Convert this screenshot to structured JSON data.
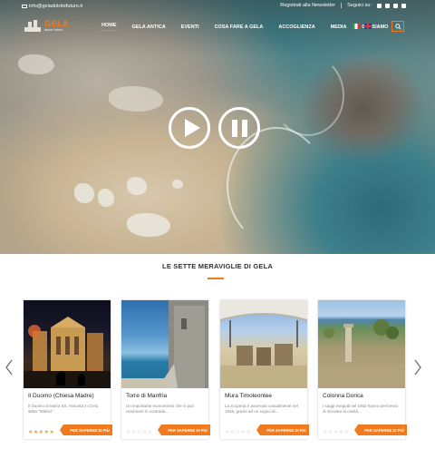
{
  "topbar": {
    "email": "info@geladolcitefuturo.it",
    "newsletter": "Registrati alla Newsletter",
    "follow": "Seguici su:",
    "social_icons": [
      "facebook-icon",
      "twitter-icon",
      "instagram-icon",
      "youtube-icon"
    ]
  },
  "logo": {
    "word": "GELA",
    "sub": "dolce futuro"
  },
  "nav": {
    "items": [
      "HOME",
      "GELA ANTICA",
      "EVENTI",
      "COSA FARE A GELA",
      "ACCOGLIENZA",
      "MEDIA",
      "CHI SIAMO"
    ],
    "active": "HOME"
  },
  "languages": [
    "it",
    "en"
  ],
  "section": {
    "title": "LE SETTE MERAVIGLIE DI GELA"
  },
  "cards": [
    {
      "name": "Il Duomo (Chiesa Madre)",
      "desc": "Il Duomo di Maria SS. Assunta in Cielo, detta \"Matrici\"",
      "stars": "★★★★★",
      "stars_filled": 5,
      "more": "PER SAPERNE DI PIÙ"
    },
    {
      "name": "Torre di Manfria",
      "desc": "Un importante monumento che si può osservare in contrada...",
      "stars": "☆☆☆☆☆",
      "stars_filled": 0,
      "more": "PER SAPERNE DI PIÙ"
    },
    {
      "name": "Mura Timoleontee",
      "desc": "La scoperta è avvenuta casualmente nel 1948, grazie ad un sogno di...",
      "stars": "☆☆☆☆☆",
      "stars_filled": 0,
      "more": "PER SAPERNE DI PIÙ"
    },
    {
      "name": "Colonna Dorica",
      "desc": "I saggi eseguiti nel 1952 hanno permesso di ritrovare la cavità...",
      "stars": "☆☆☆☆☆",
      "stars_filled": 0,
      "more": "PER SAPERNE DI PIÙ"
    }
  ],
  "colors": {
    "accent": "#f07b1e",
    "star": "#f0a22a"
  }
}
